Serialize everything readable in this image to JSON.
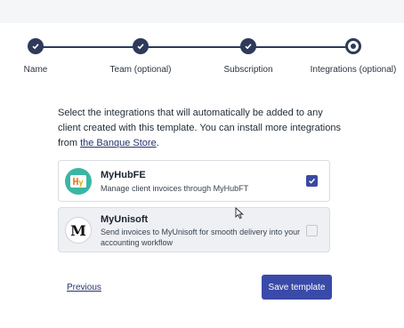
{
  "stepper": {
    "steps": [
      {
        "label": "Name",
        "state": "done"
      },
      {
        "label": "Team (optional)",
        "state": "done"
      },
      {
        "label": "Subscription",
        "state": "done"
      },
      {
        "label": "Integrations (optional)",
        "state": "current"
      }
    ]
  },
  "intro": {
    "text_before": "Select the integrations that will automatically be added to any client created with this template. You can install more integrations from ",
    "link": "the Banque Store",
    "text_after": "."
  },
  "integrations": [
    {
      "name": "MyHubFE",
      "description": "Manage client invoices through MyHubFT",
      "checked": true,
      "icon": "myhubfe-logo"
    },
    {
      "name": "MyUnisoft",
      "description": "Send invoices to MyUnisoft for smooth delivery into your accounting workflow",
      "checked": false,
      "icon": "myunisoft-logo",
      "logo_letter": "M"
    }
  ],
  "footer": {
    "previous_label": "Previous",
    "save_label": "Save template"
  },
  "colors": {
    "primary": "#3a4aa8",
    "stepper": "#2e3a59",
    "myhubfe_brand": "#3bb6a4"
  }
}
